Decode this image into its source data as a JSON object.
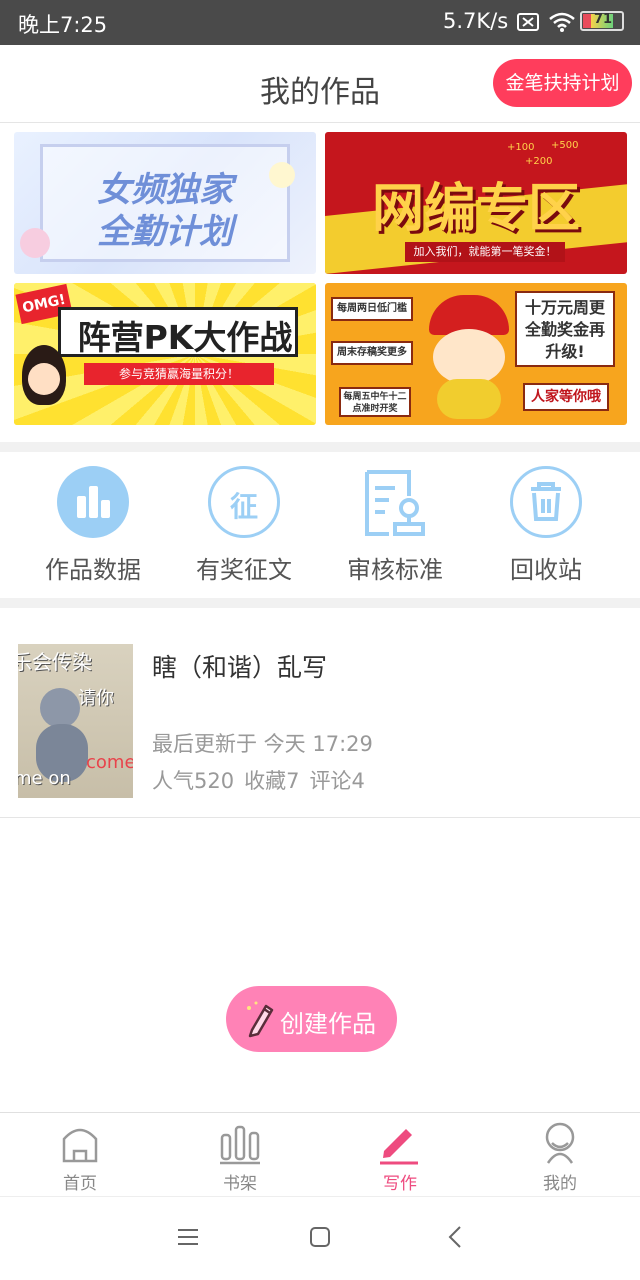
{
  "status_bar": {
    "time": "晚上7:25",
    "net_speed": "5.7K/s",
    "battery_level": "71",
    "icons": [
      "sim-off-icon",
      "wifi-icon",
      "battery-icon"
    ]
  },
  "header": {
    "title": "我的作品",
    "plan_button": "金笔扶持计划"
  },
  "banners": [
    {
      "name": "female-exclusive-banner",
      "line1": "女频独家",
      "line2": "全勤计划"
    },
    {
      "name": "web-editor-zone-banner",
      "headline": "网编专区",
      "subline": "加入我们，就能第一笔奖金！",
      "badges": [
        "+100",
        "+500",
        "+200"
      ]
    },
    {
      "name": "camp-pk-banner",
      "tag": "OMG!",
      "headline": "阵营PK大作战",
      "subline": "参与竞猜赢海量积分！"
    },
    {
      "name": "weekly-bonus-banner",
      "labels": [
        "每周两日低门槛",
        "周末存稿奖更多",
        "每周五中午十二点准时开奖"
      ],
      "headline": "十万元周更全勤奖金再升级!",
      "footer": "人家等你哦"
    }
  ],
  "features": [
    {
      "label": "作品数据",
      "icon": "bar-chart-icon"
    },
    {
      "label": "有奖征文",
      "icon": "contest-icon"
    },
    {
      "label": "审核标准",
      "icon": "review-standard-icon"
    },
    {
      "label": "回收站",
      "icon": "trash-icon"
    }
  ],
  "works": [
    {
      "title": "瞎（和谐）乱写",
      "updated": "最后更新于 今天 17:29",
      "popularity": "人气520",
      "favorites": "收藏7",
      "comments": "评论4",
      "cover_text": [
        "乐会传染",
        "请你",
        "come",
        "me on"
      ]
    }
  ],
  "create_button": "创建作品",
  "bottom_nav": [
    {
      "label": "首页",
      "icon": "home-icon",
      "active": false
    },
    {
      "label": "书架",
      "icon": "bookshelf-icon",
      "active": false
    },
    {
      "label": "写作",
      "icon": "pen-icon",
      "active": true
    },
    {
      "label": "我的",
      "icon": "profile-icon",
      "active": false
    }
  ],
  "colors": {
    "accent_pink": "#ee4b7f",
    "plan_red": "#ff3d5c",
    "feature_blue": "#9ccff5"
  }
}
